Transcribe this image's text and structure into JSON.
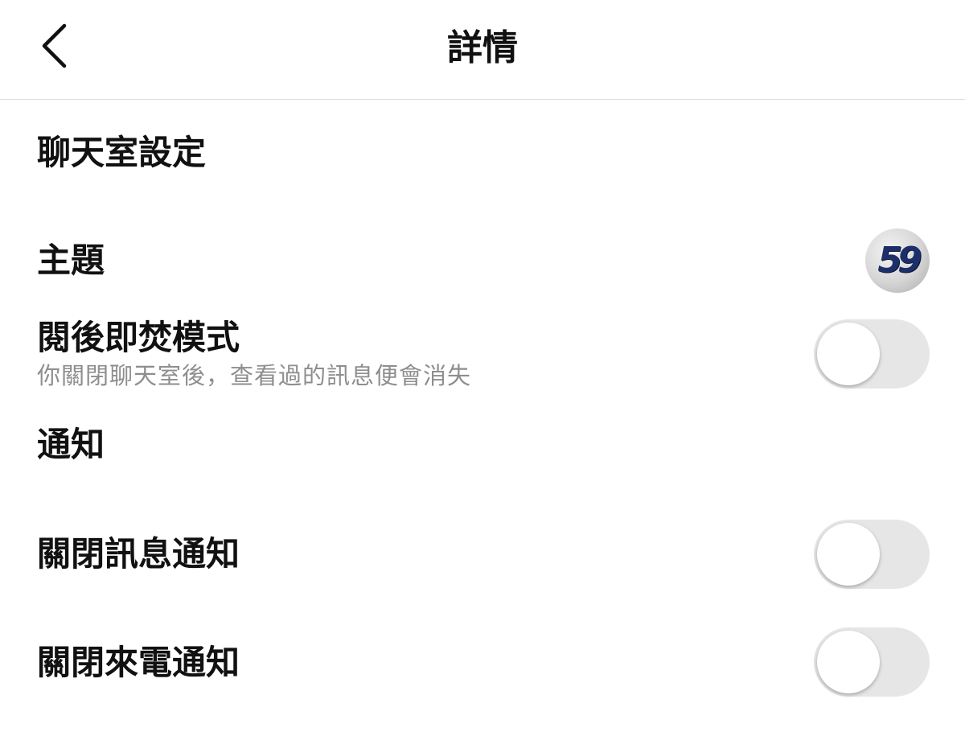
{
  "header": {
    "title": "詳情",
    "back_icon": "chevron-left-icon"
  },
  "chat_settings": {
    "title": "聊天室設定",
    "theme": {
      "label": "主題",
      "avatar_text": "59"
    },
    "vanish_mode": {
      "label": "閱後即焚模式",
      "description": "你關閉聊天室後，查看過的訊息便會消失",
      "enabled": false
    }
  },
  "notifications": {
    "title": "通知",
    "mute_messages": {
      "label": "關閉訊息通知",
      "enabled": false
    },
    "mute_calls": {
      "label": "關閉來電通知",
      "enabled": false
    }
  },
  "colors": {
    "toggle_off_track": "#e6e6e6",
    "subtext": "#8e8e8e",
    "divider": "#dcdcdc"
  }
}
